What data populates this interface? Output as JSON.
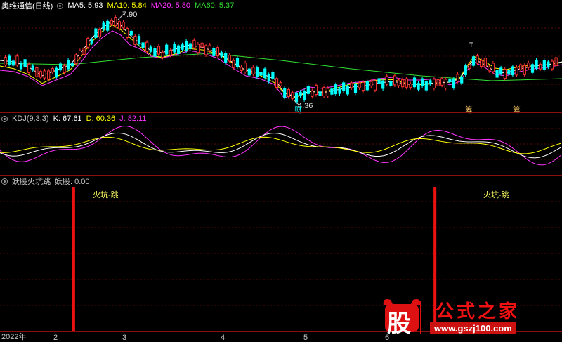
{
  "main": {
    "title": "奥维通信(日线)",
    "ma": [
      {
        "label": "MA5: 5.93",
        "color": "#ffffff"
      },
      {
        "label": "MA10: 5.84",
        "color": "#ffff00"
      },
      {
        "label": "MA20: 5.80",
        "color": "#ff33ff"
      },
      {
        "label": "MA60: 5.37",
        "color": "#33dd33"
      }
    ],
    "high_label": "7.90",
    "low_label": "4.36",
    "markers": [
      "财",
      "筹",
      "筹"
    ],
    "top_marker": "T"
  },
  "kdj": {
    "title": "KDJ(9,3,3)",
    "k": "K: 67.61",
    "d": "D: 60.36",
    "j": "J: 82.11"
  },
  "yao": {
    "title": "妖股火坑跳",
    "value": "妖股: 0.00",
    "signal_label": "火坑-跳",
    "signals": [
      {
        "date_index": 18,
        "value": 1
      },
      {
        "date_index": 108,
        "value": 1
      }
    ]
  },
  "xaxis": [
    "2022年",
    "2",
    "3",
    "4",
    "5",
    "6"
  ],
  "watermark": {
    "char": "股",
    "name": "公式之家",
    "url": "www.gszj100.com"
  },
  "colors": {
    "up": "#ff3333",
    "down": "#00ffff",
    "bg": "#000000",
    "sep": "#8a1010",
    "label": "#ffff66"
  }
}
